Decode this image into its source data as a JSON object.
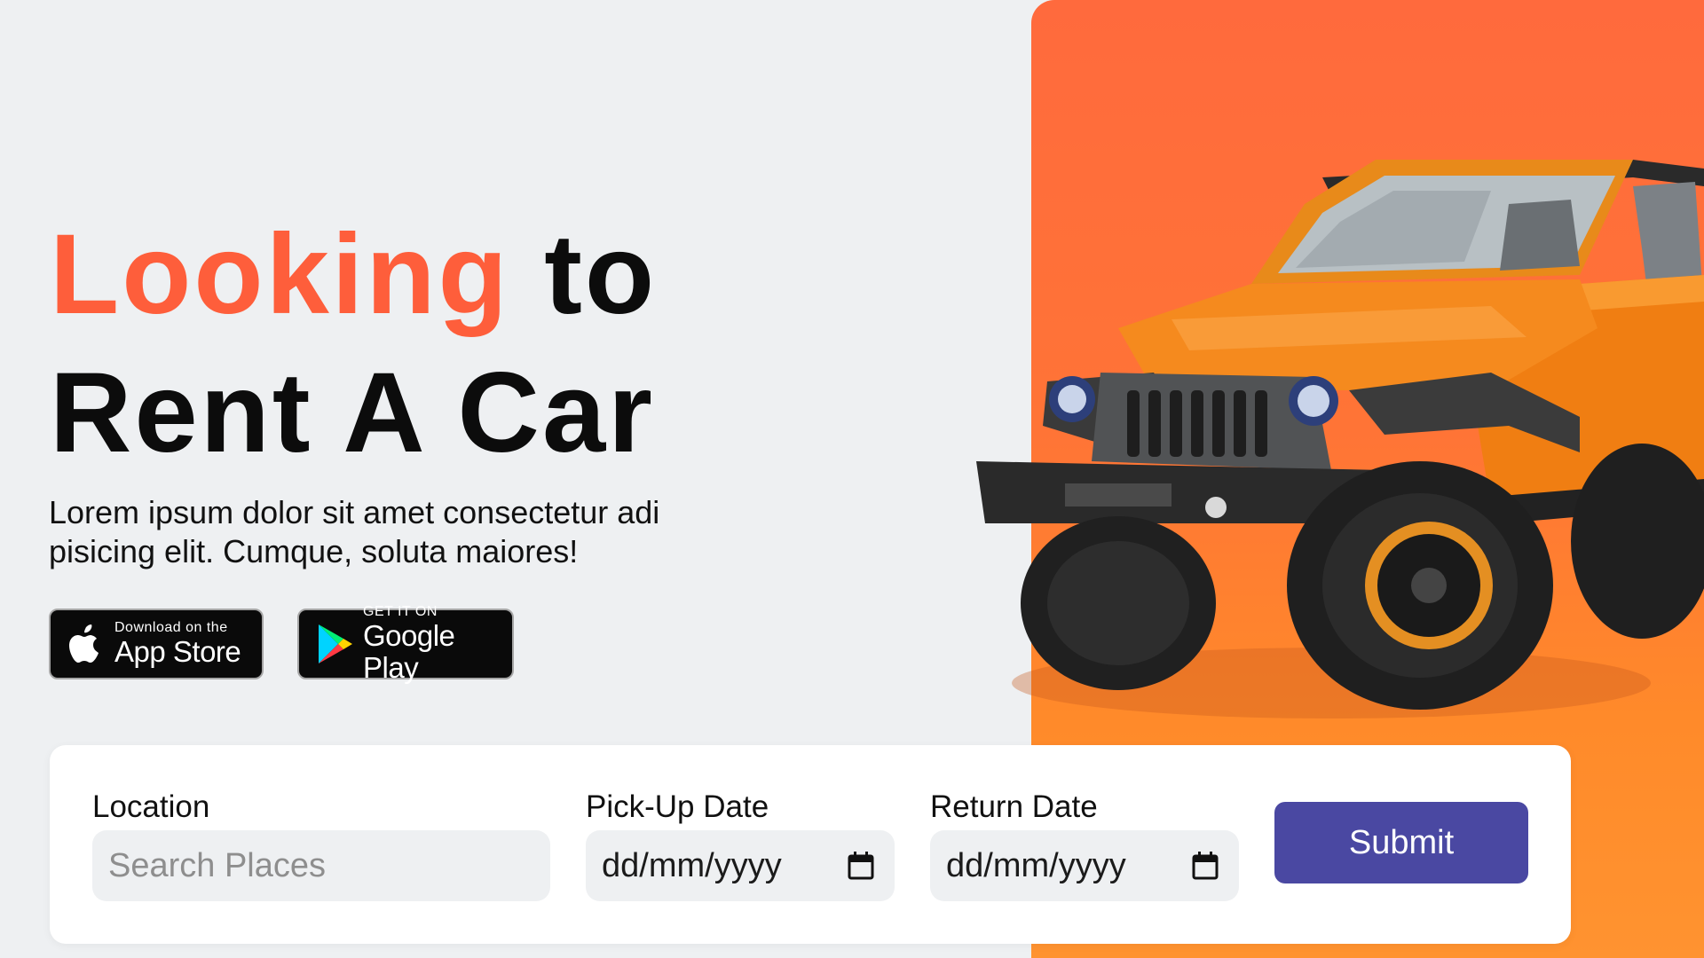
{
  "hero": {
    "headline_accent": "Looking",
    "headline_rest_line1": " to",
    "headline_line2": "Rent A Car",
    "description": "Lorem ipsum dolor sit amet consectetur adi pisicing elit. Cumque, soluta maiores!"
  },
  "stores": {
    "apple": {
      "small": "Download on the",
      "big": "App Store",
      "icon": "apple-icon"
    },
    "google": {
      "small": "GET IT ON",
      "big": "Google Play",
      "icon": "google-play-icon"
    }
  },
  "booking": {
    "location": {
      "label": "Location",
      "placeholder": "Search Places",
      "value": ""
    },
    "pickup": {
      "label": "Pick-Up Date",
      "value": "dd/mm/yyyy",
      "icon": "calendar-icon"
    },
    "return": {
      "label": "Return Date",
      "value": "dd/mm/yyyy",
      "icon": "calendar-icon"
    },
    "submit_label": "Submit"
  },
  "colors": {
    "accent": "#fe5e3b",
    "panel": "#ff7436",
    "button": "#4a48a2",
    "background": "#eef0f2"
  }
}
